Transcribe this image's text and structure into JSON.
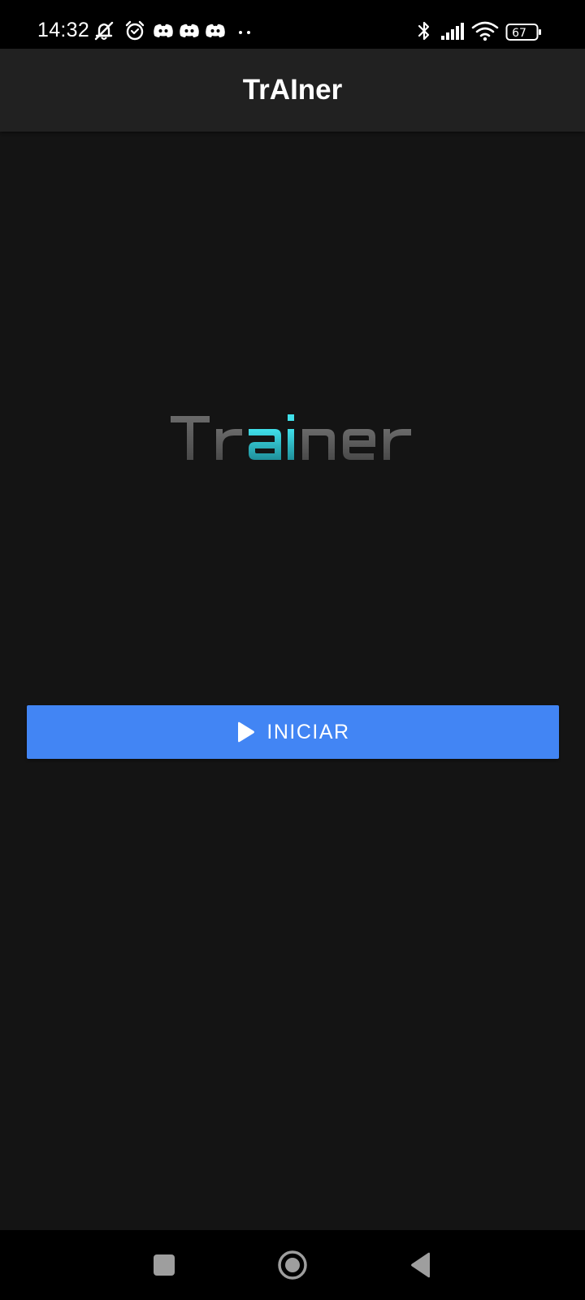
{
  "status_bar": {
    "time": "14:32",
    "battery_level": "67",
    "left_icons": [
      "muted-alarm-icon",
      "alarm-clock-icon",
      "discord-icon",
      "discord-icon",
      "discord-icon",
      "more-notifications-icon"
    ],
    "right_icons": [
      "bluetooth-icon",
      "signal-icon",
      "wifi-icon",
      "battery-icon"
    ]
  },
  "app_bar": {
    "title": "TrAIner"
  },
  "logo": {
    "text": "Trainer",
    "primary_color": "#5a5a5a",
    "accent_color": "#35d6e0"
  },
  "start_button": {
    "label": "INICIAR",
    "icon": "play-icon",
    "color": "#4285f4"
  },
  "nav_bar": {
    "buttons": [
      "recent-apps-icon",
      "home-icon",
      "back-icon"
    ]
  }
}
